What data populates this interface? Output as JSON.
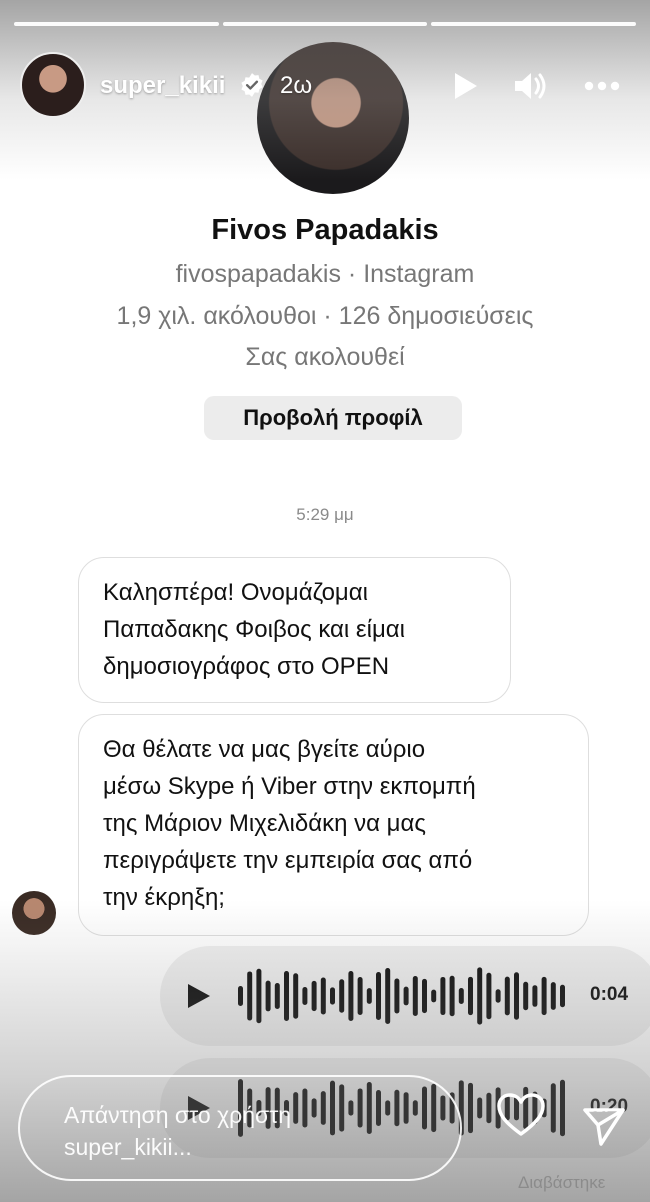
{
  "story": {
    "username": "super_kikii",
    "time_ago": "2ω",
    "segments": 3
  },
  "profile": {
    "name": "Fivos Papadakis",
    "handle_line": "fivospapadakis · Instagram",
    "stats_line": "1,9 χιλ. ακόλουθοι · 126 δημοσιεύσεις",
    "follow_status": "Σας ακολουθεί",
    "view_profile_label": "Προβολή προφίλ"
  },
  "chat": {
    "timestamp": "5:29 μμ",
    "message1_lines": [
      "Καλησπέρα! Ονομάζομαι",
      "Παπαδακης Φοιβος και είμαι",
      "δημοσιογράφος στο OPEN"
    ],
    "message2_lines": [
      "Θα θέλατε να μας βγείτε αύριο",
      "μέσω Skype ή Viber στην εκπομπή",
      "της Μάριον Μιχελιδάκη να μας",
      "περιγράψετε την εμπειρία σας από",
      "την έκρηξη;"
    ],
    "audio1_duration": "0:04",
    "audio2_duration": "0:20",
    "read_receipt": "Διαβάστηκε"
  },
  "reply": {
    "placeholder_line1": "Απάντηση στο χρήστη",
    "placeholder_line2": "super_kikii..."
  },
  "icons": {
    "verified": "verified-badge-icon",
    "play": "play-icon",
    "volume": "volume-icon",
    "more": "more-options-icon",
    "heart": "heart-icon",
    "send": "send-icon"
  },
  "colors": {
    "bubble_border": "#dedede",
    "audio_bg": "#efefef",
    "muted_text": "#777777"
  }
}
